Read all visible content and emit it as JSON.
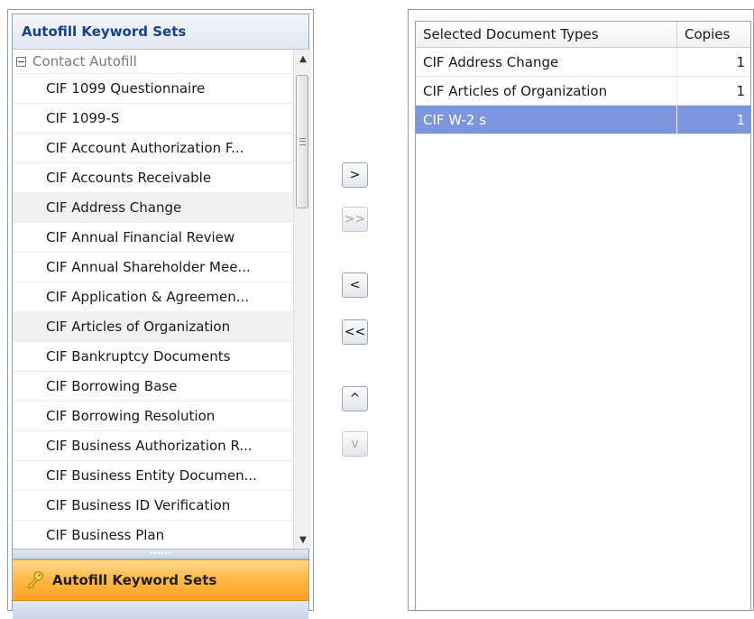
{
  "left_panel": {
    "header": "Autofill Keyword Sets",
    "group": {
      "label": "Contact Autofill",
      "toggle_glyph": "−"
    },
    "items": [
      {
        "label": "CIF 1099 Questionnaire",
        "selected": false
      },
      {
        "label": "CIF 1099-S",
        "selected": false
      },
      {
        "label": "CIF Account Authorization F...",
        "selected": false
      },
      {
        "label": "CIF Accounts Receivable",
        "selected": false
      },
      {
        "label": "CIF Address Change",
        "selected": true
      },
      {
        "label": "CIF Annual Financial Review",
        "selected": false
      },
      {
        "label": "CIF Annual Shareholder Mee...",
        "selected": false
      },
      {
        "label": "CIF Application & Agreemen...",
        "selected": false
      },
      {
        "label": "CIF Articles of Organization",
        "selected": true
      },
      {
        "label": "CIF Bankruptcy Documents",
        "selected": false
      },
      {
        "label": "CIF Borrowing Base",
        "selected": false
      },
      {
        "label": "CIF Borrowing Resolution",
        "selected": false
      },
      {
        "label": "CIF Business Authorization R...",
        "selected": false
      },
      {
        "label": "CIF Business Entity Documen...",
        "selected": false
      },
      {
        "label": "CIF Business ID Verification",
        "selected": false
      },
      {
        "label": "CIF Business Plan",
        "selected": false
      }
    ],
    "footer_button": "Autofill Keyword Sets",
    "footer_icon": "key-icon"
  },
  "transfer_buttons": {
    "add": ">",
    "add_all": ">>",
    "remove": "<",
    "remove_all": "<<",
    "move_up": "^",
    "move_down": "v"
  },
  "right_panel": {
    "columns": [
      "Selected Document Types",
      "Copies"
    ],
    "rows": [
      {
        "type": "CIF Address Change",
        "copies": "1",
        "selected": false
      },
      {
        "type": "CIF Articles of Organization",
        "copies": "1",
        "selected": false
      },
      {
        "type": "CIF W-2 s",
        "copies": "1",
        "selected": true
      }
    ]
  },
  "colors": {
    "header_text": "#15428b",
    "selection": "#7c95dd",
    "footer_orange": "#ffb43d"
  }
}
